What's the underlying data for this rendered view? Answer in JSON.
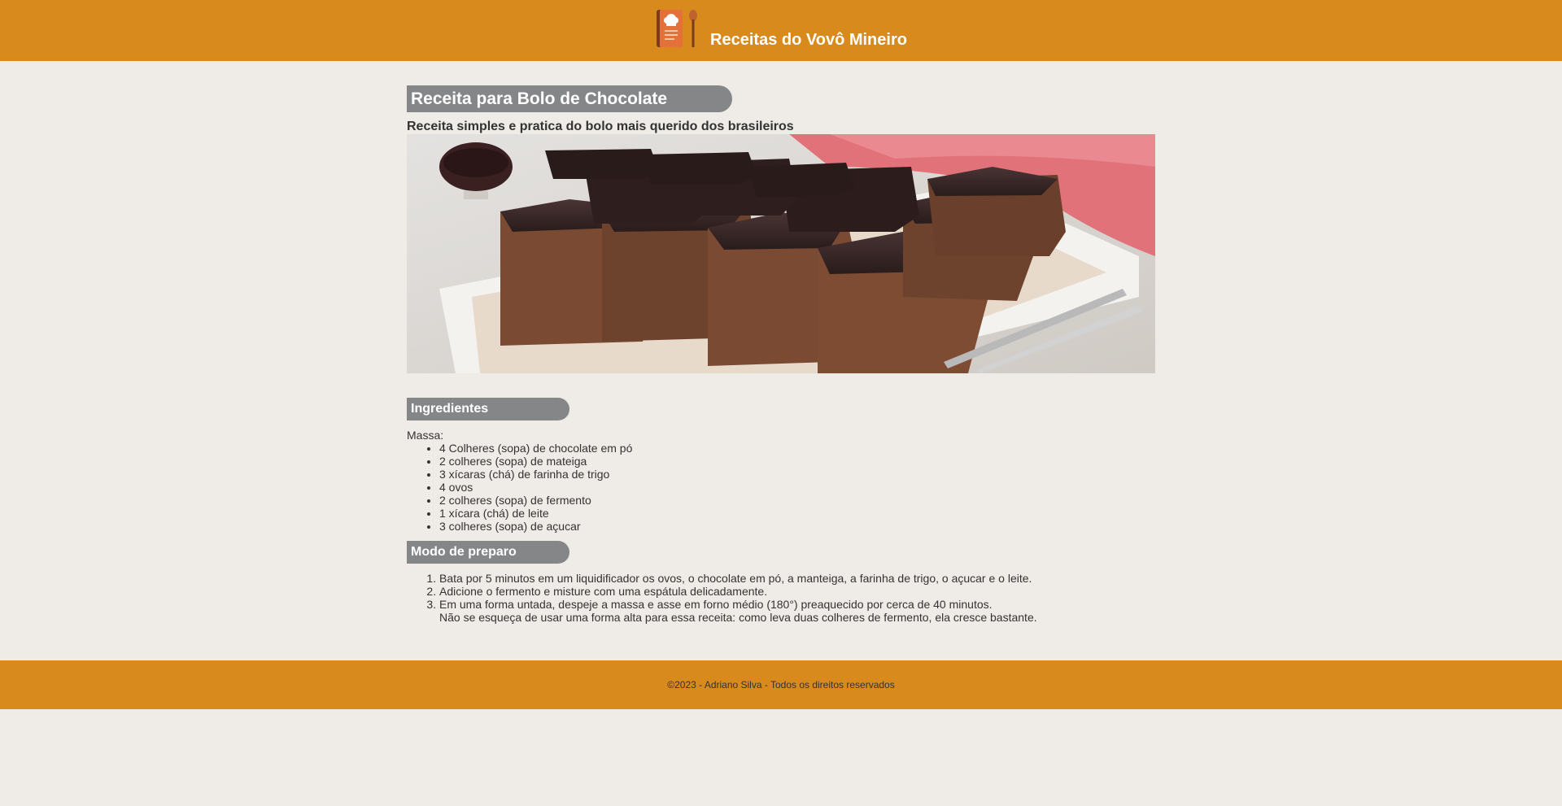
{
  "header": {
    "logo_icon": "recipe-book-icon",
    "title": "Receitas do Vovô Mineiro"
  },
  "recipe": {
    "title": "Receita para Bolo de Chocolate",
    "subtitle": "Receita simples e pratica do bolo mais querido dos brasileiros",
    "photo": "chocolate-cake-photo"
  },
  "ingredients": {
    "heading": "Ingredientes",
    "group_label": "Massa:",
    "items": [
      "4 Colheres (sopa) de chocolate em pó",
      "2 colheres (sopa) de mateiga",
      "3 xícaras (chá) de farinha de trigo",
      "4 ovos",
      "2 colheres (sopa) de fermento",
      "1 xícara (chá) de leite",
      "3 colheres (sopa) de açucar"
    ]
  },
  "preparation": {
    "heading": "Modo de preparo",
    "steps": [
      "Bata por 5 minutos em um liquidificador os ovos, o chocolate em pó, a manteiga, a farinha de trigo, o açucar e o leite.",
      "Adicione o fermento e misture com uma espátula delicadamente.",
      "Em uma forma untada, despeje a massa e asse em forno médio (180°) preaquecido por cerca de 40 minutos."
    ],
    "note": "Não se esqueça de usar uma forma alta para essa receita: como leva duas colheres de fermento, ela cresce bastante."
  },
  "footer": {
    "copyright": "©2023 - Adriano Silva - Todos os direitos reservados"
  },
  "colors": {
    "header_bg": "#d88a1c",
    "page_bg": "#efebe6",
    "pill_bg": "#858688"
  }
}
